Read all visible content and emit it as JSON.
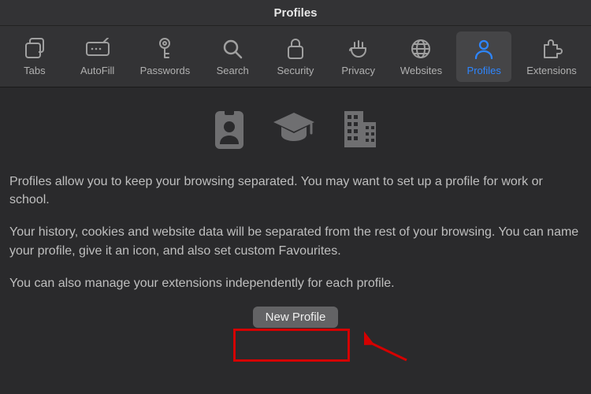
{
  "window": {
    "title": "Profiles"
  },
  "toolbar": {
    "items": [
      {
        "id": "tabs",
        "label": "Tabs",
        "icon": "tabs-icon"
      },
      {
        "id": "autofill",
        "label": "AutoFill",
        "icon": "autofill-icon"
      },
      {
        "id": "passwords",
        "label": "Passwords",
        "icon": "passwords-icon"
      },
      {
        "id": "search",
        "label": "Search",
        "icon": "search-icon"
      },
      {
        "id": "security",
        "label": "Security",
        "icon": "security-icon"
      },
      {
        "id": "privacy",
        "label": "Privacy",
        "icon": "privacy-icon"
      },
      {
        "id": "websites",
        "label": "Websites",
        "icon": "websites-icon"
      },
      {
        "id": "profiles",
        "label": "Profiles",
        "icon": "profiles-icon"
      },
      {
        "id": "extensions",
        "label": "Extensions",
        "icon": "extensions-icon"
      }
    ],
    "active": "profiles"
  },
  "content": {
    "illustration_icons": [
      "badge-icon",
      "graduation-cap-icon",
      "building-icon"
    ],
    "paragraph1": "Profiles allow you to keep your browsing separated. You may want to set up a profile for work or school.",
    "paragraph2": "Your history, cookies and website data will be separated from the rest of your browsing. You can name your profile, give it an icon, and also set custom Favourites.",
    "paragraph3": "You can also manage your extensions independently for each profile.",
    "new_profile_label": "New Profile"
  },
  "annotation": {
    "highlight_target": "new-profile-button",
    "arrow": true,
    "colors": {
      "highlight": "#d40000",
      "arrow": "#d40000"
    }
  }
}
